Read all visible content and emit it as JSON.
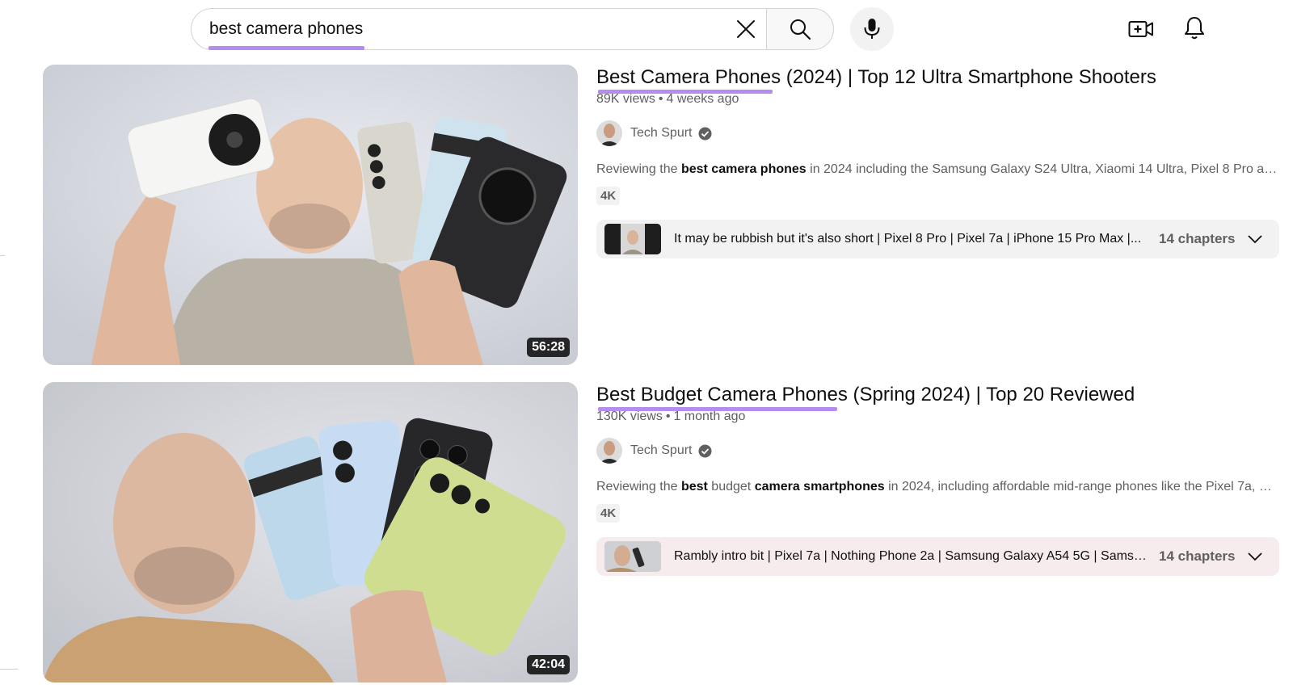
{
  "search": {
    "query": "best camera phones"
  },
  "icons": {
    "clear": "close-icon",
    "search": "search-icon",
    "mic": "microphone-icon",
    "create": "create-video-icon",
    "notifications": "bell-icon"
  },
  "colors": {
    "highlight": "#b58cf0",
    "meta_text": "#606060"
  },
  "results": [
    {
      "title": "Best Camera Phones (2024) | Top 12 Ultra Smartphone Shooters",
      "views": "89K views",
      "age": "4 weeks ago",
      "channel": "Tech Spurt",
      "description_parts": [
        {
          "text": "Reviewing the ",
          "bold": false
        },
        {
          "text": "best camera phones",
          "bold": true
        },
        {
          "text": " in 2024 including the Samsung Galaxy S24 Ultra, Xiaomi 14 Ultra, Pixel 8 Pro and ...",
          "bold": false
        }
      ],
      "badge": "4K",
      "duration": "56:28",
      "chapters_text": "It may be rubbish but it's also short | Pixel 8 Pro | Pixel 7a | iPhone 15 Pro Max |...",
      "chapters_count": "14 chapters"
    },
    {
      "title": "Best Budget Camera Phones (Spring 2024) | Top 20 Reviewed",
      "views": "130K views",
      "age": "1 month ago",
      "channel": "Tech Spurt",
      "description_parts": [
        {
          "text": "Reviewing the ",
          "bold": false
        },
        {
          "text": "best",
          "bold": true
        },
        {
          "text": " budget ",
          "bold": false
        },
        {
          "text": "camera smartphones",
          "bold": true
        },
        {
          "text": " in 2024, including affordable mid-range phones like the Pixel 7a, Noth...",
          "bold": false
        }
      ],
      "badge": "4K",
      "duration": "42:04",
      "chapters_text": "Rambly intro bit | Pixel 7a | Nothing Phone 2a | Samsung Galaxy A54 5G | Samsung...",
      "chapters_count": "14 chapters"
    }
  ]
}
